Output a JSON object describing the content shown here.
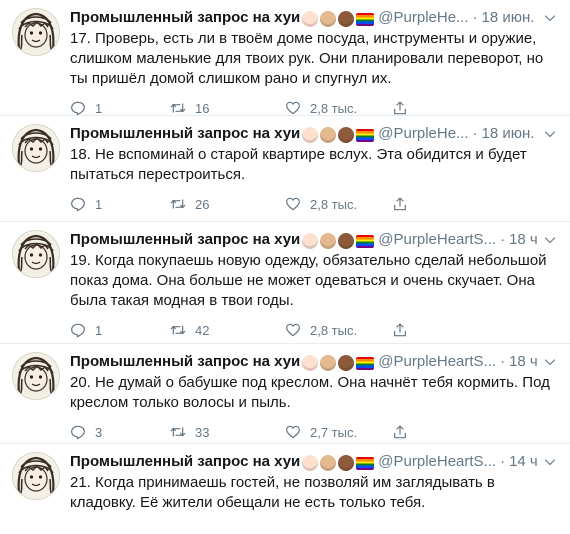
{
  "tweets": [
    {
      "name": "Промышленный запрос на хуи",
      "handle": "@PurpleHe...",
      "dot": "·",
      "time": "18 июн.",
      "text": "17. Проверь, есть ли в твоём доме посуда, инструменты и оружие, слишком маленькие для твоих рук. Они планировали переворот, но ты пришёл домой слишком рано и спугнул их.",
      "replies": "1",
      "retweets": "16",
      "likes": "2,8 тыс."
    },
    {
      "name": "Промышленный запрос на хуи",
      "handle": "@PurpleHe...",
      "dot": "·",
      "time": "18 июн.",
      "text": "18. Не вспоминай о старой квартире вслух. Эта обидится и будет пытаться перестроиться.",
      "replies": "1",
      "retweets": "26",
      "likes": "2,8 тыс."
    },
    {
      "name": "Промышленный запрос на хуи",
      "handle": "@PurpleHeartS...",
      "dot": "·",
      "time": "18 ч",
      "text": "19. Когда покупаешь новую одежду, обязательно сделай небольшой показ дома. Она больше не может одеваться и очень скучает. Она была такая модная в твои годы.",
      "replies": "1",
      "retweets": "42",
      "likes": "2,8 тыс."
    },
    {
      "name": "Промышленный запрос на хуи",
      "handle": "@PurpleHeartS...",
      "dot": "·",
      "time": "18 ч",
      "text": "20. Не думай о бабушке под креслом. Она начнёт тебя кормить. Под креслом только волосы и пыль.",
      "replies": "3",
      "retweets": "33",
      "likes": "2,7 тыс."
    },
    {
      "name": "Промышленный запрос на хуи",
      "handle": "@PurpleHeartS...",
      "dot": "·",
      "time": "14 ч",
      "text": "21. Когда принимаешь гостей, не позволяй им заглядывать в кладовку. Её жители обещали не есть только тебя.",
      "replies": "",
      "retweets": "",
      "likes": ""
    }
  ],
  "emoji_skin_tones": [
    "#fde0d0",
    "#e4b98f",
    "#8d5a3b"
  ],
  "pride_colors": [
    "#e40303",
    "#ff8c00",
    "#ffed00",
    "#008026",
    "#004dff",
    "#750787"
  ],
  "icons": [
    "avatar-drawing",
    "chevron-down-icon",
    "reply-icon",
    "retweet-icon",
    "like-icon",
    "share-icon"
  ]
}
